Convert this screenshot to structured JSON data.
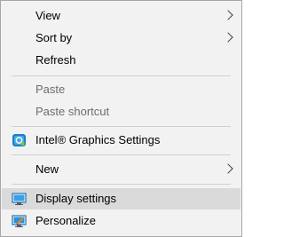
{
  "menu": {
    "view_label": "View",
    "sort_by_label": "Sort by",
    "refresh_label": "Refresh",
    "paste_label": "Paste",
    "paste_shortcut_label": "Paste shortcut",
    "intel_graphics_label": "Intel® Graphics Settings",
    "new_label": "New",
    "display_settings_label": "Display settings",
    "personalize_label": "Personalize"
  },
  "icons": {
    "intel": "intel-graphics-icon",
    "display": "display-settings-icon",
    "personalize": "personalize-icon"
  },
  "colors": {
    "menu_bg": "#f2f2f2",
    "hover_bg": "#dadada",
    "disabled_text": "#6d6d6d",
    "separator": "#cfcfcf"
  }
}
